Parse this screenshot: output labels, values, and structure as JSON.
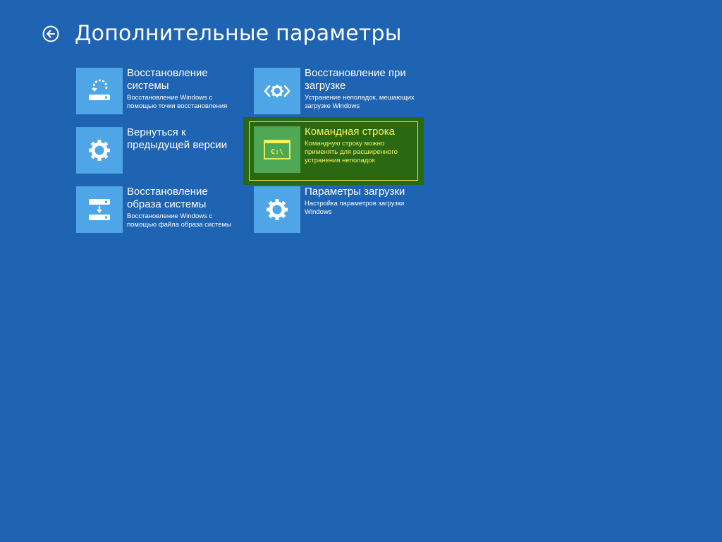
{
  "header": {
    "title": "Дополнительные параметры"
  },
  "tiles": [
    {
      "title": "Восстановление системы",
      "desc": "Восстановление Windows с помощью точки восстановления",
      "icon": "system-restore-icon"
    },
    {
      "title": "Восстановление при загрузке",
      "desc": "Устранение неполадок, мешающих загрузке Windows",
      "icon": "startup-repair-icon"
    },
    {
      "title": "Вернуться к предыдущей версии",
      "desc": "",
      "icon": "gear-icon"
    },
    {
      "title": "Командная строка",
      "desc": "Командную строку можно применять для расширенного устранения неполадок",
      "icon": "command-prompt-icon",
      "glyph": "C:\\"
    },
    {
      "title": "Восстановление образа системы",
      "desc": "Восстановление Windows с помощью файла образа системы",
      "icon": "system-image-recovery-icon"
    },
    {
      "title": "Параметры загрузки",
      "desc": "Настройка параметров загрузки Windows",
      "icon": "gear-icon"
    }
  ],
  "colors": {
    "background": "#1f63b3",
    "tile_icon": "#4ea6e6",
    "selected_bg": "#2a6912",
    "selected_icon": "#4ea854",
    "selected_text": "#f3f35a"
  }
}
